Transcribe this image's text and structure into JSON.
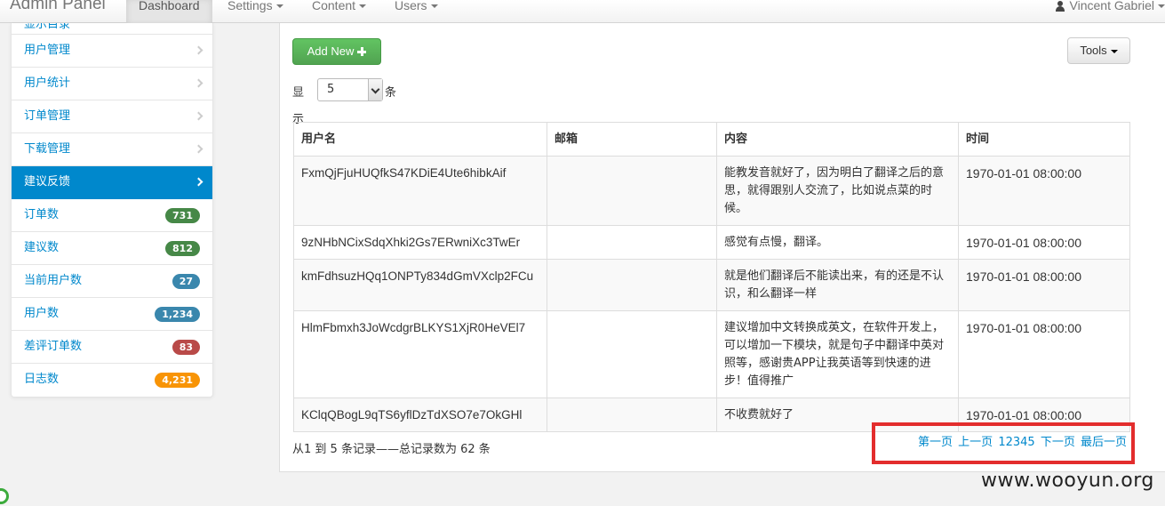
{
  "navbar": {
    "brand": "Admin Panel",
    "items": [
      {
        "label": "Dashboard",
        "active": true,
        "dropdown": false
      },
      {
        "label": "Settings",
        "dropdown": true
      },
      {
        "label": "Content",
        "dropdown": true
      },
      {
        "label": "Users",
        "dropdown": true
      }
    ],
    "user": "Vincent Gabriel"
  },
  "sidebar": {
    "partial_top": "显示目录",
    "items": [
      {
        "label": "用户管理",
        "type": "link"
      },
      {
        "label": "用户统计",
        "type": "link"
      },
      {
        "label": "订单管理",
        "type": "link"
      },
      {
        "label": "下载管理",
        "type": "link"
      },
      {
        "label": "建议反馈",
        "type": "link",
        "active": true
      },
      {
        "label": "订单数",
        "badge": "731",
        "badge_color": "#468847"
      },
      {
        "label": "建议数",
        "badge": "812",
        "badge_color": "#468847"
      },
      {
        "label": "当前用户数",
        "badge": "27",
        "badge_color": "#3a87ad"
      },
      {
        "label": "用户数",
        "badge": "1,234",
        "badge_color": "#3a87ad"
      },
      {
        "label": "差评订单数",
        "badge": "83",
        "badge_color": "#b94a48"
      },
      {
        "label": "日志数",
        "badge": "4,231",
        "badge_color": "#f89406"
      }
    ]
  },
  "toolbar": {
    "add_label": "Add New",
    "tools_label": "Tools",
    "show_prefix": "显示",
    "show_value": "5",
    "show_suffix": "条"
  },
  "table": {
    "headers": [
      "用户名",
      "邮箱",
      "内容",
      "时间"
    ],
    "rows": [
      {
        "user": "FxmQjFjuHUQfkS47KDiE4Ute6hibkAif",
        "email": "",
        "content": "能教发音就好了，因为明白了翻译之后的意思，就得跟别人交流了，比如说点菜的时候。",
        "time": "1970-01-01 08:00:00"
      },
      {
        "user": "9zNHbNCixSdqXhki2Gs7ERwniXc3TwEr",
        "email": "",
        "content": "感觉有点慢，翻译。",
        "time": "1970-01-01 08:00:00"
      },
      {
        "user": "kmFdhsuzHQq1ONPTy834dGmVXclp2FCu",
        "email": "",
        "content": "就是他们翻译后不能读出来，有的还是不认识，和么翻译一样",
        "time": "1970-01-01 08:00:00"
      },
      {
        "user": "HlmFbmxh3JoWcdgrBLKYS1XjR0HeVEl7",
        "email": "",
        "content": "建议增加中文转换成英文，在软件开发上，可以增加一下模块，就是句子中翻译中英对照等，感谢贵APP让我英语等到快速的进步！值得推广",
        "time": "1970-01-01 08:00:00"
      },
      {
        "user": "KClqQBogL9qTS6yflDzTdXSO7e7OkGHl",
        "email": "",
        "content": "不收费就好了",
        "time": "1970-01-01 08:00:00"
      }
    ]
  },
  "summary": "从1 到 5 条记录——总记录数为 62 条",
  "pager": {
    "first": "第一页",
    "prev": "上一页",
    "pages": "12345",
    "next": "下一页",
    "last": "最后一页"
  },
  "watermark": "www.wooyun.org"
}
